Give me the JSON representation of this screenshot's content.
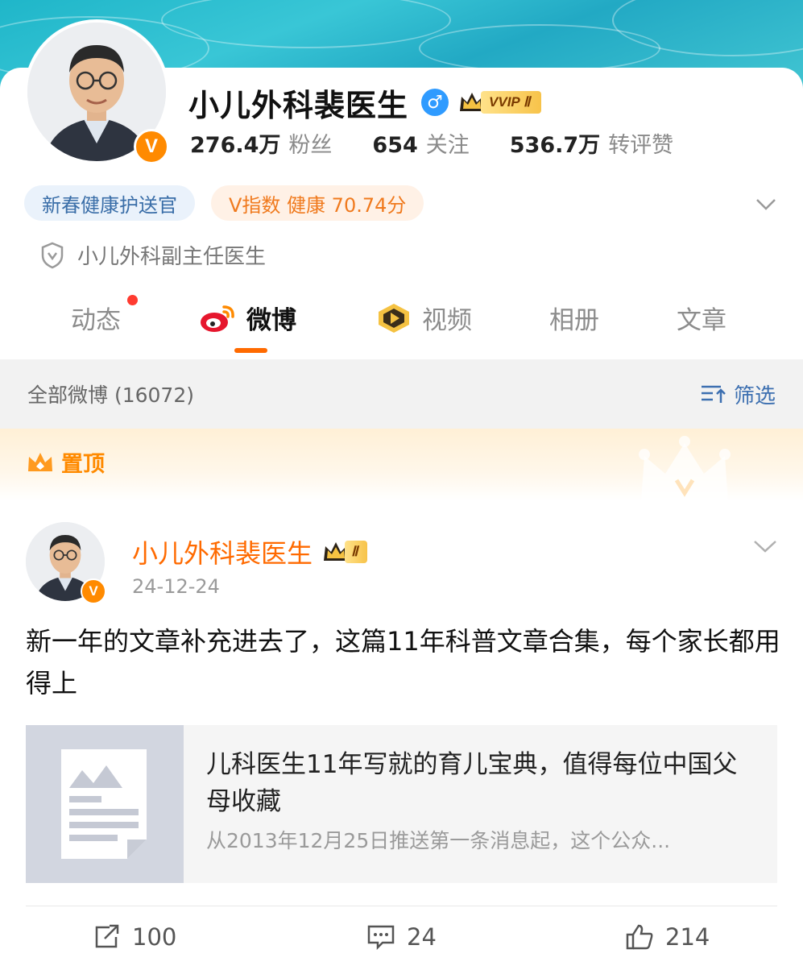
{
  "profile": {
    "name": "小儿外科裴医生",
    "gender_symbol": "♂",
    "vvip_label": "VVIP Ⅱ",
    "stats": [
      {
        "value": "276.4万",
        "label": "粉丝"
      },
      {
        "value": "654",
        "label": "关注"
      },
      {
        "value": "536.7万",
        "label": "转评赞"
      }
    ],
    "tags": [
      "新春健康护送官",
      "V指数 健康 70.74分"
    ],
    "verification": "小儿外科副主任医生",
    "v_badge": "V"
  },
  "tabs": [
    {
      "label": "动态",
      "active": false,
      "has_dot": true
    },
    {
      "label": "微博",
      "active": true,
      "icon": "weibo-logo-icon"
    },
    {
      "label": "视频",
      "active": false,
      "icon": "video-play-icon"
    },
    {
      "label": "相册",
      "active": false
    },
    {
      "label": "文章",
      "active": false
    }
  ],
  "filter": {
    "count_label": "全部微博 (16072)",
    "filter_label": "筛选"
  },
  "pinned": {
    "label": "置顶"
  },
  "post": {
    "author": "小儿外科裴医生",
    "member_label": "Ⅱ",
    "date": "24-12-24",
    "text": "新一年的文章补充进去了，这篇11年科普文章合集，每个家长都用得上",
    "article": {
      "title": "儿科医生11年写就的育儿宝典，值得每位中国父母收藏",
      "description": "从2013年12月25日推送第一条消息起，这个公众..."
    },
    "actions": {
      "repost": "100",
      "comment": "24",
      "like": "214"
    }
  },
  "colors": {
    "accent_orange": "#ff6a00",
    "link_blue": "#3c6fb0",
    "vip_gold": "#f7c34a"
  }
}
